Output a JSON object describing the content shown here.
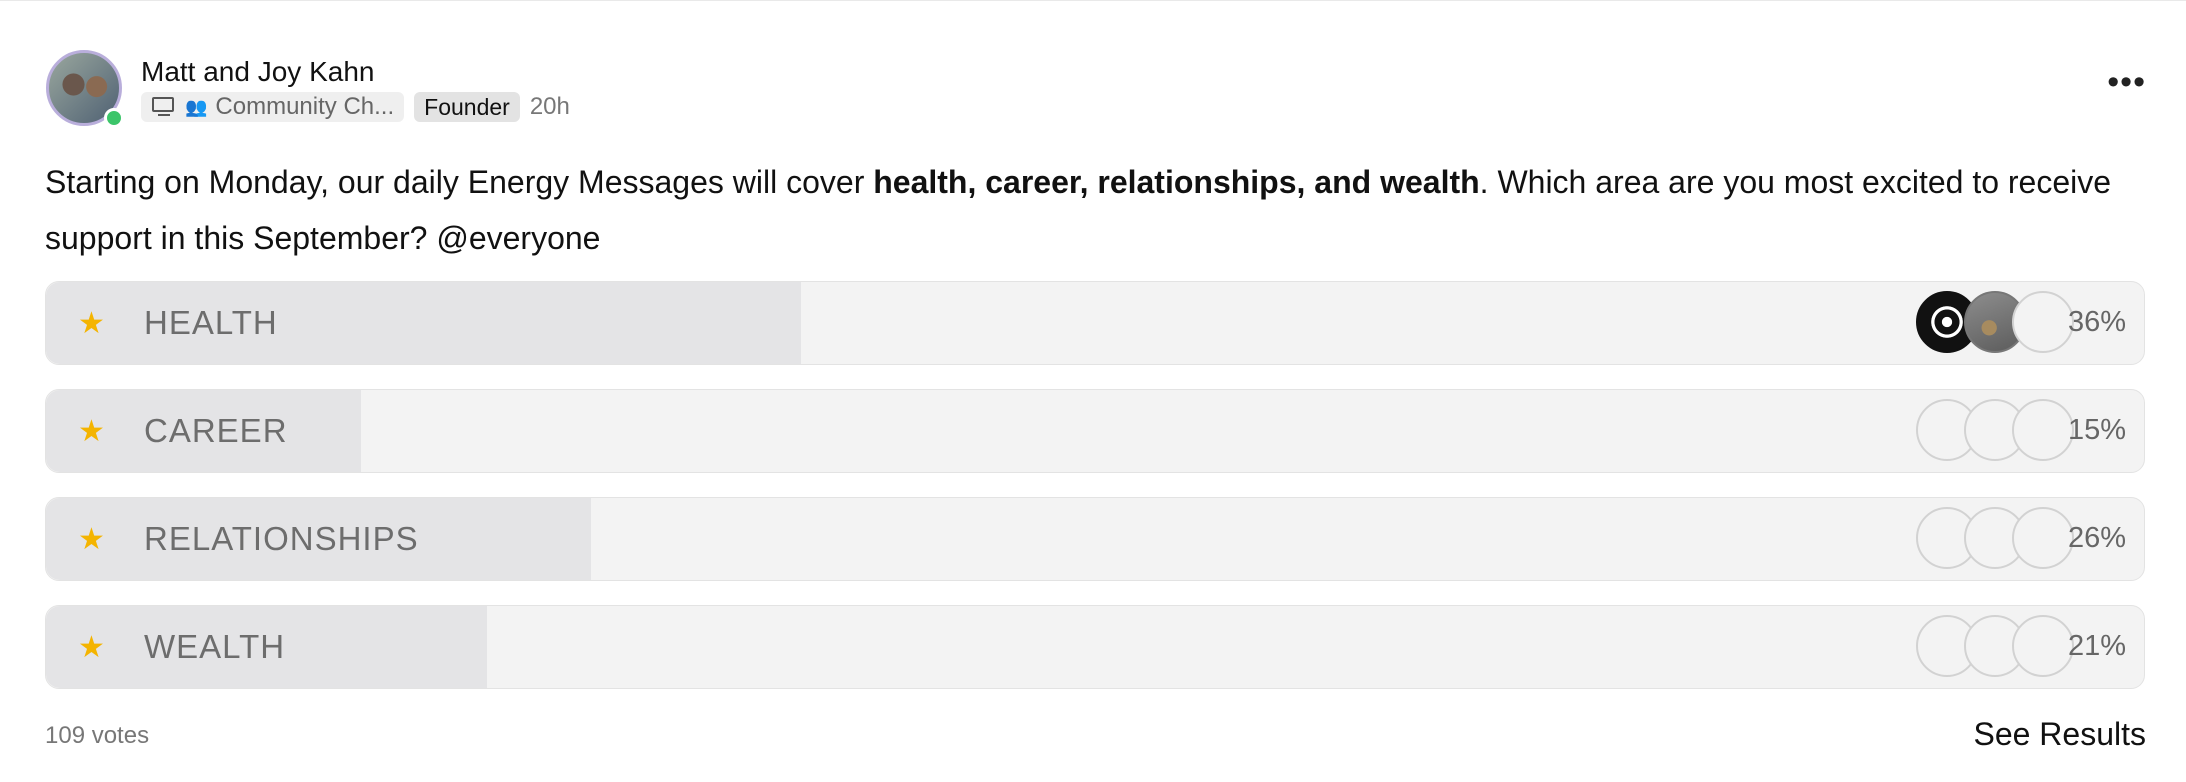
{
  "post": {
    "author": "Matt and Joy Kahn",
    "channel": "Community Ch...",
    "badge": "Founder",
    "time": "20h",
    "more_label": "•••",
    "body_start": "Starting on Monday, our daily Energy Messages will cover ",
    "body_bold": "health, career, relationships, and wealth",
    "body_end": ". Which area are you most excited to receive support in this September? @everyone"
  },
  "poll": {
    "options": [
      {
        "label": "HEALTH",
        "percent": "36%",
        "fill": 36
      },
      {
        "label": "CAREER",
        "percent": "15%",
        "fill": 15
      },
      {
        "label": "RELATIONSHIPS",
        "percent": "26%",
        "fill": 26
      },
      {
        "label": "WEALTH",
        "percent": "21%",
        "fill": 21
      }
    ],
    "votes": "109 votes",
    "see_results": "See Results"
  },
  "icons": {
    "option_icon": "star-icon",
    "channel_icon": "monitor-icon",
    "people_icon": "people-icon",
    "more_icon": "more-icon"
  },
  "colors": {
    "online": "#3cc56a",
    "bar_fill": "#e4e4e6",
    "bar_track": "#f3f3f3"
  }
}
